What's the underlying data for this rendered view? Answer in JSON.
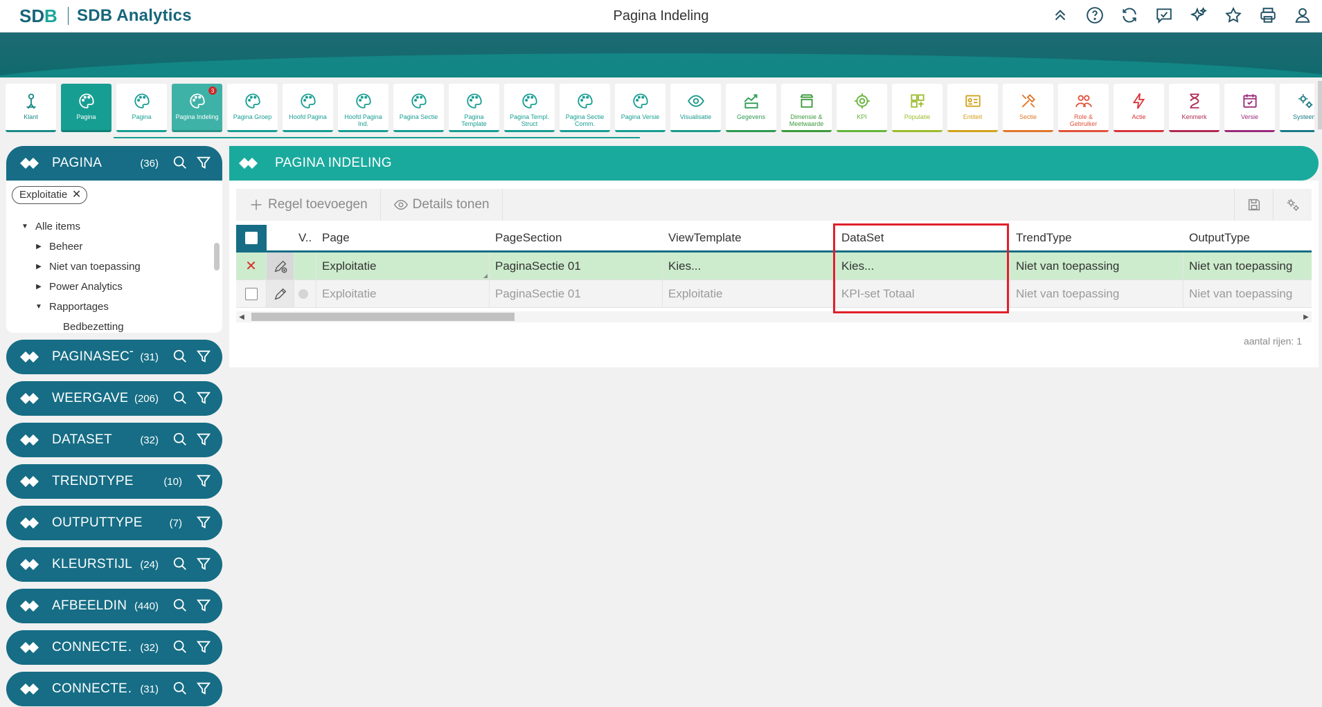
{
  "app": {
    "logo_text": "SDB Analytics",
    "page_title": "Pagina Indeling"
  },
  "top_actions": [
    {
      "name": "collapse-up-icon"
    },
    {
      "name": "help-icon"
    },
    {
      "name": "refresh-icon"
    },
    {
      "name": "check-message-icon"
    },
    {
      "name": "sparkle-star-icon"
    },
    {
      "name": "favorite-star-icon"
    },
    {
      "name": "print-icon"
    },
    {
      "name": "user-icon"
    }
  ],
  "tiles": [
    {
      "label": "Klant",
      "color": "#1a8a86",
      "icon": "person"
    },
    {
      "label": "Pagina",
      "color": "#179e92",
      "icon": "palette",
      "state": "active"
    },
    {
      "label": "Pagina",
      "color": "#179e92",
      "icon": "palette"
    },
    {
      "label": "Pagina Indeling",
      "color": "#179e92",
      "icon": "palette",
      "state": "soft",
      "badge": "3"
    },
    {
      "label": "Pagina Groep",
      "color": "#179e92",
      "icon": "palette"
    },
    {
      "label": "Hoofd Pagina",
      "color": "#179e92",
      "icon": "palette"
    },
    {
      "label": "Hoofd Pagina Ind.",
      "color": "#179e92",
      "icon": "palette"
    },
    {
      "label": "Pagina Sectie",
      "color": "#179e92",
      "icon": "palette"
    },
    {
      "label": "Pagina Template",
      "color": "#179e92",
      "icon": "palette"
    },
    {
      "label": "Pagina Templ. Struct",
      "color": "#179e92",
      "icon": "palette"
    },
    {
      "label": "Pagina Sectie Comm.",
      "color": "#179e92",
      "icon": "palette"
    },
    {
      "label": "Pagina Versie",
      "color": "#179e92",
      "icon": "palette"
    },
    {
      "label": "Visualisatie",
      "color": "#1a9a8a",
      "icon": "eye"
    },
    {
      "label": "Gegevens",
      "color": "#2e9a52",
      "icon": "chart"
    },
    {
      "label": "Dimensie & Meetwaarde",
      "color": "#3c9a3c",
      "icon": "dims"
    },
    {
      "label": "KPI",
      "color": "#64b43a",
      "icon": "target"
    },
    {
      "label": "Populatie",
      "color": "#9cbc2e",
      "icon": "puzzle"
    },
    {
      "label": "Entiteit",
      "color": "#d2a21c",
      "icon": "card"
    },
    {
      "label": "Sectie",
      "color": "#e0762a",
      "icon": "tools"
    },
    {
      "label": "Role & Gebruiker",
      "color": "#e2513a",
      "icon": "users"
    },
    {
      "label": "Actie",
      "color": "#d8343a",
      "icon": "bolt"
    },
    {
      "label": "Kenmerk",
      "color": "#b02a52",
      "icon": "hourglass"
    },
    {
      "label": "Versie",
      "color": "#9a2a7a",
      "icon": "calendar"
    },
    {
      "label": "Systeem",
      "color": "#1a7a86",
      "icon": "gears"
    }
  ],
  "left_panels": {
    "first": {
      "title": "PAGINA",
      "count": "(36)"
    },
    "filter_chip": "Exploitatie",
    "tree": [
      {
        "label": "Alle items",
        "level": 0,
        "caret": "down"
      },
      {
        "label": "Beheer",
        "level": 1,
        "caret": "right"
      },
      {
        "label": "Niet van toepassing",
        "level": 1,
        "caret": "right"
      },
      {
        "label": "Power Analytics",
        "level": 1,
        "caret": "right"
      },
      {
        "label": "Rapportages",
        "level": 1,
        "caret": "down"
      },
      {
        "label": "Bedbezetting",
        "level": 2,
        "caret": ""
      }
    ],
    "others": [
      {
        "title": "PAGINASECTIE",
        "count": "(31)",
        "search": true
      },
      {
        "title": "WEERGAVE…",
        "count": "(206)",
        "search": true
      },
      {
        "title": "DATASET",
        "count": "(32)",
        "search": true
      },
      {
        "title": "TRENDTYPE",
        "count": "(10)",
        "search": false
      },
      {
        "title": "OUTPUTTYPE",
        "count": "(7)",
        "search": false
      },
      {
        "title": "KLEURSTIJL",
        "count": "(24)",
        "search": true
      },
      {
        "title": "AFBEELDING",
        "count": "(440)",
        "search": true
      },
      {
        "title": "CONNECTE…",
        "count": "(32)",
        "search": true
      },
      {
        "title": "CONNECTE…",
        "count": "(31)",
        "search": true
      }
    ]
  },
  "main": {
    "title": "PAGINA INDELING",
    "toolbar": {
      "add_label": "Regel toevoegen",
      "details_label": "Details tonen"
    },
    "columns": {
      "v": "V..",
      "page": "Page",
      "section": "PageSection",
      "view": "ViewTemplate",
      "dataset": "DataSet",
      "trend": "TrendType",
      "output": "OutputType"
    },
    "rows": [
      {
        "v": "",
        "page": "Exploitatie",
        "section": "PaginaSectie 01",
        "view": "Kies...",
        "dataset": "Kies...",
        "trend": "Niet van toepassing",
        "output": "Niet van toepassing",
        "state": "editing"
      },
      {
        "v": "",
        "page": "Exploitatie",
        "section": "PaginaSectie 01",
        "view": "Exploitatie",
        "dataset": "KPI-set Totaal",
        "trend": "Niet van toepassing",
        "output": "Niet van toepassing",
        "state": "inactive"
      }
    ],
    "row_count": "aantal rijen: 1"
  }
}
